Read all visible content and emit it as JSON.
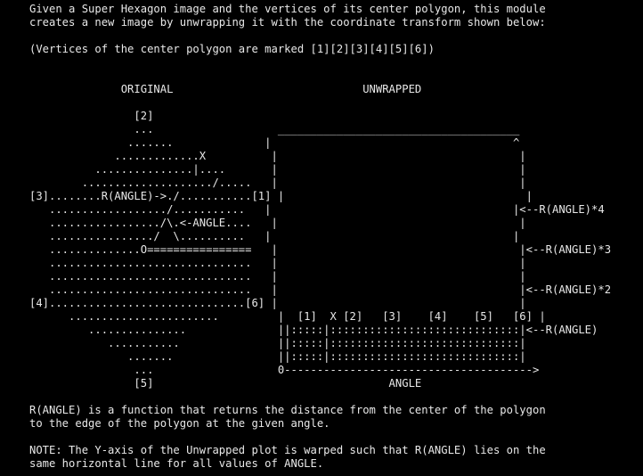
{
  "text_lines": [
    "Given a Super Hexagon image and the vertices of its center polygon, this module",
    "creates a new image by unwrapping it with the coordinate transform shown below:",
    "",
    "(Vertices of the center polygon are marked [1][2][3][4][5][6])",
    "",
    "",
    "              ORIGINAL                             UNWRAPPED",
    "",
    "                [2]",
    "                ...                   _____________________________________",
    "               .......              |                                     ^",
    "             .............X          |                                     |",
    "          ...............|....       |                                     |",
    "        ..................../.....   |                                     |",
    "[3]........R(ANGLE)->./...........[1] |                                     |",
    "   ................../...........   |                                     |<--R(ANGLE)*4",
    "   ................./\\.<-ANGLE....   |                                     |",
    "   ................/  \\..........   |                                     |",
    "   ..............O================   |                                     |<--R(ANGLE)*3",
    "   ...............................   |                                     |",
    "   ...............................   |                                     |",
    "   ...............................   |                                     |<--R(ANGLE)*2",
    "[4]..............................[6] |                                     |",
    "      .......................         |  [1]  X [2]   [3]    [4]    [5]   [6] |",
    "         ...............              ||:::::|:::::::::::::::::::::::::::::|<--R(ANGLE)",
    "            ...........               ||:::::|:::::::::::::::::::::::::::::|",
    "               .......                ||:::::|:::::::::::::::::::::::::::::|",
    "                ...                   0-------------------------------------->",
    "                [5]                                    ANGLE",
    "",
    "R(ANGLE) is a function that returns the distance from the center of the polygon",
    "to the edge of the polygon at the given angle.",
    "",
    "NOTE: The Y-axis of the Unwrapped plot is warped such that R(ANGLE) lies on the",
    "same horizontal line for all values of ANGLE."
  ]
}
